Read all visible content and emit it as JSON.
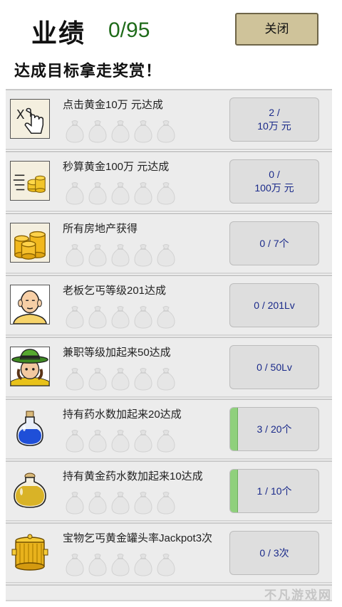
{
  "header": {
    "title": "业绩",
    "counter": "0/95",
    "close_label": "关闭",
    "subtitle": "达成目标拿走奖赏！"
  },
  "achievements": [
    {
      "label": "点击黄金10万 元达成",
      "icon": "tap-hand-icon",
      "progress_text": "2 /\n10万 元",
      "progress": 0.0
    },
    {
      "label": "秒算黄金100万 元达成",
      "icon": "coin-stack-icon",
      "progress_text": "0 /\n100万 元",
      "progress": 0.0
    },
    {
      "label": "所有房地产获得",
      "icon": "gold-coins-icon",
      "progress_text": "0 / 7个",
      "progress": 0.0
    },
    {
      "label": "老板乞丐等级201达成",
      "icon": "beggar-boss-icon",
      "progress_text": "0 / 201Lv",
      "progress": 0.0
    },
    {
      "label": "兼职等级加起来50达成",
      "icon": "green-hat-man-icon",
      "progress_text": "0 / 50Lv",
      "progress": 0.0
    },
    {
      "label": "持有药水数加起来20达成",
      "icon": "blue-potion-icon",
      "progress_text": "3 / 20个",
      "progress": 0.15
    },
    {
      "label": "持有黄金药水数加起来10达成",
      "icon": "gold-potion-icon",
      "progress_text": "1 / 10个",
      "progress": 0.1
    },
    {
      "label": "宝物乞丐黄金罐头率Jackpot3次",
      "icon": "gold-pot-icon",
      "progress_text": "0 / 3次",
      "progress": 0.0
    }
  ],
  "watermark": "不凡游戏网",
  "colors": {
    "counter": "#1f6b1a",
    "close_bg": "#cfc39a",
    "fill": "#8fd07c",
    "progress_text": "#1a2a8a"
  }
}
